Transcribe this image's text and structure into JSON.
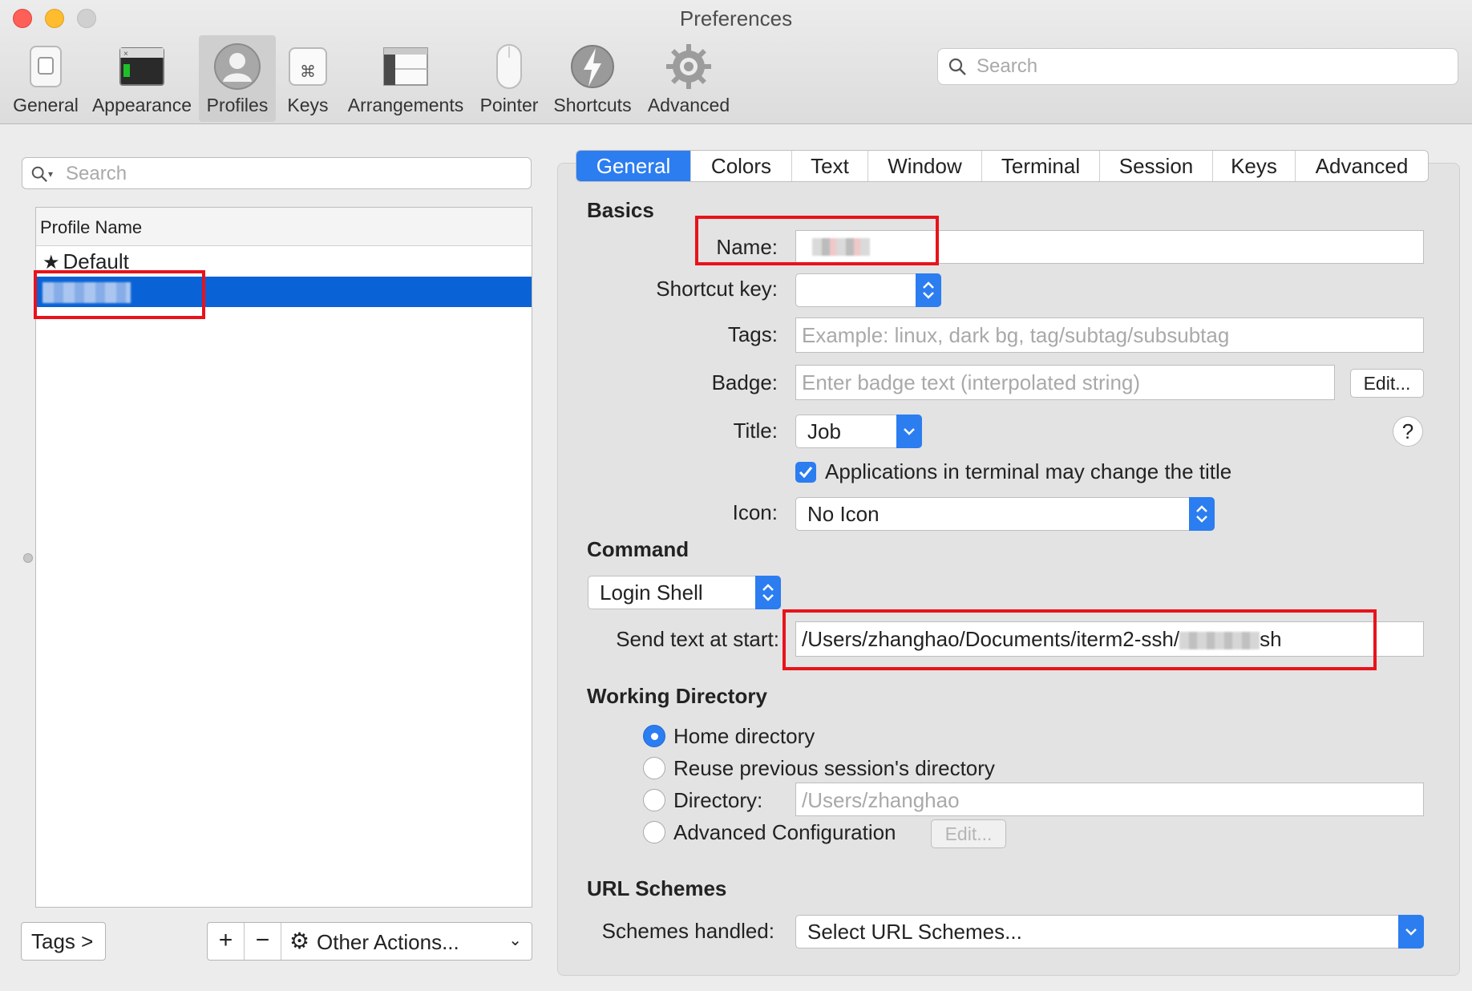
{
  "window": {
    "title": "Preferences"
  },
  "toolbar": {
    "items": [
      {
        "label": "General",
        "icon": "general-switch-icon"
      },
      {
        "label": "Appearance",
        "icon": "appearance-terminal-icon"
      },
      {
        "label": "Profiles",
        "icon": "profiles-person-icon",
        "selected": true
      },
      {
        "label": "Keys",
        "icon": "keys-command-icon"
      },
      {
        "label": "Arrangements",
        "icon": "arrangements-windows-icon"
      },
      {
        "label": "Pointer",
        "icon": "pointer-mouse-icon"
      },
      {
        "label": "Shortcuts",
        "icon": "shortcuts-bolt-icon"
      },
      {
        "label": "Advanced",
        "icon": "advanced-gear-icon"
      }
    ],
    "search_placeholder": "Search"
  },
  "profiles": {
    "search_placeholder": "Search",
    "column_header": "Profile Name",
    "rows": [
      {
        "label": "Default",
        "default": true
      },
      {
        "label": "",
        "selected": true,
        "redacted": true
      }
    ],
    "tags_button": "Tags >",
    "add_button": "+",
    "remove_button": "−",
    "other_actions": "Other Actions..."
  },
  "tabs": [
    "General",
    "Colors",
    "Text",
    "Window",
    "Terminal",
    "Session",
    "Keys",
    "Advanced"
  ],
  "active_tab": "General",
  "basics": {
    "heading": "Basics",
    "name_label": "Name:",
    "name_value": "",
    "shortcut_label": "Shortcut key:",
    "shortcut_value": "",
    "tags_label": "Tags:",
    "tags_placeholder": "Example: linux, dark bg, tag/subtag/subsubtag",
    "badge_label": "Badge:",
    "badge_placeholder": "Enter badge text (interpolated string)",
    "badge_edit": "Edit...",
    "title_label": "Title:",
    "title_value": "Job",
    "help": "?",
    "apps_change_title": "Applications in terminal may change the title",
    "apps_change_title_checked": true,
    "icon_label": "Icon:",
    "icon_value": "No Icon"
  },
  "command": {
    "heading": "Command",
    "mode": "Login Shell",
    "send_text_label": "Send text at start:",
    "send_text_prefix": "/Users/zhanghao/Documents/iterm2-ssh/",
    "send_text_suffix": "sh"
  },
  "working_directory": {
    "heading": "Working Directory",
    "options": [
      {
        "label": "Home directory",
        "selected": true
      },
      {
        "label": "Reuse previous session's directory",
        "selected": false
      },
      {
        "label": "Directory:",
        "selected": false
      },
      {
        "label": "Advanced Configuration",
        "selected": false
      }
    ],
    "directory_placeholder": "/Users/zhanghao",
    "advanced_edit": "Edit..."
  },
  "url_schemes": {
    "heading": "URL Schemes",
    "label": "Schemes handled:",
    "value": "Select URL Schemes..."
  },
  "colors": {
    "accent": "#2b7df0",
    "selection": "#0a63d6",
    "highlight_box": "#e8131b"
  }
}
